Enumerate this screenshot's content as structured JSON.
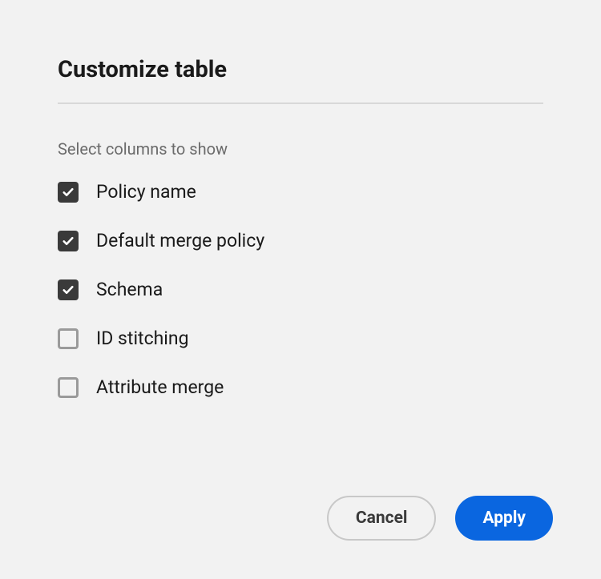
{
  "dialog": {
    "title": "Customize table",
    "subtitle": "Select columns to show"
  },
  "columns": [
    {
      "label": "Policy name",
      "checked": true
    },
    {
      "label": "Default merge policy",
      "checked": true
    },
    {
      "label": "Schema",
      "checked": true
    },
    {
      "label": "ID stitching",
      "checked": false
    },
    {
      "label": "Attribute merge",
      "checked": false
    }
  ],
  "buttons": {
    "cancel": "Cancel",
    "apply": "Apply"
  }
}
